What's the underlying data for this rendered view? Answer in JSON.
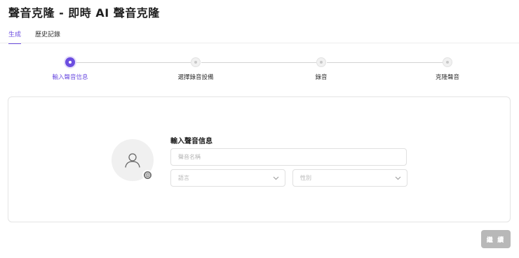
{
  "header": {
    "title": "聲音克隆 - 即時 AI 聲音克隆"
  },
  "tabs": [
    {
      "label": "生成",
      "active": true
    },
    {
      "label": "歷史記錄",
      "active": false
    }
  ],
  "steps": [
    {
      "label": "輸入聲音信息",
      "active": true
    },
    {
      "label": "選擇錄音設備",
      "active": false
    },
    {
      "label": "錄音",
      "active": false
    },
    {
      "label": "克隆聲音",
      "active": false
    }
  ],
  "form": {
    "title": "輸入聲音信息",
    "name_placeholder": "聲音名稱",
    "language_placeholder": "語言",
    "gender_placeholder": "性別"
  },
  "footer": {
    "continue_label": "繼 續"
  },
  "colors": {
    "accent": "#6c4ee0",
    "disabled_button": "#b8b8b8"
  }
}
